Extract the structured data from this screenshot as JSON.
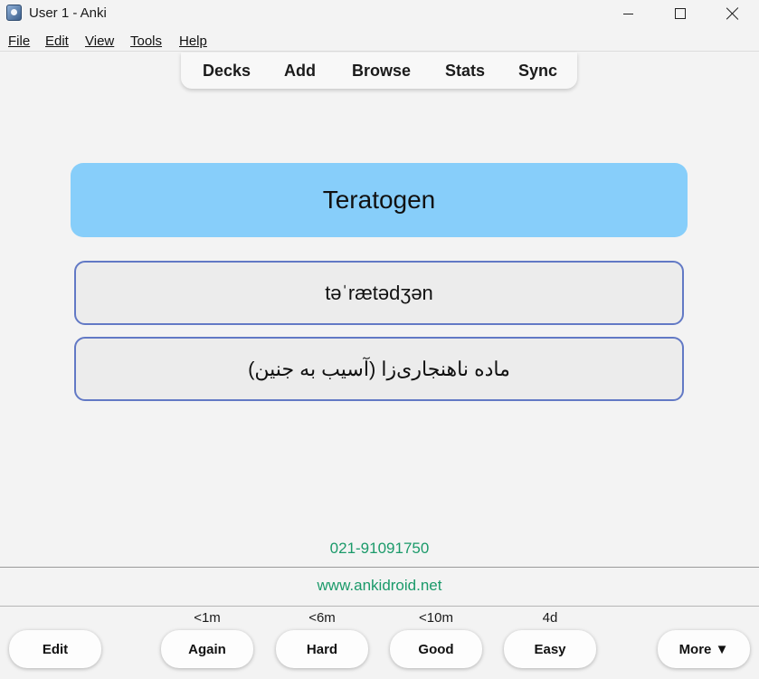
{
  "window": {
    "title": "User 1 - Anki"
  },
  "menu": {
    "items": [
      {
        "label": "File"
      },
      {
        "label": "Edit"
      },
      {
        "label": "View"
      },
      {
        "label": "Tools"
      },
      {
        "label": "Help"
      }
    ]
  },
  "toolbar": {
    "items": [
      {
        "label": "Decks"
      },
      {
        "label": "Add"
      },
      {
        "label": "Browse"
      },
      {
        "label": "Stats"
      },
      {
        "label": "Sync"
      }
    ]
  },
  "card": {
    "front": "Teratogen",
    "phonetic": "təˈrætədʒən",
    "translation": "ماده ناهنجاری‌زا (آسیب به جنین)",
    "phone": "021-91091750",
    "website": "www.ankidroid.net"
  },
  "answer_bar": {
    "edit_label": "Edit",
    "more_label": "More ▼",
    "buttons": [
      {
        "label": "Again",
        "interval": "<1m"
      },
      {
        "label": "Hard",
        "interval": "<6m"
      },
      {
        "label": "Good",
        "interval": "<10m"
      },
      {
        "label": "Easy",
        "interval": "4d"
      }
    ]
  },
  "colors": {
    "front_card": "#87cefa",
    "box_border": "#6279c5",
    "link_green": "#1b9a6a"
  }
}
